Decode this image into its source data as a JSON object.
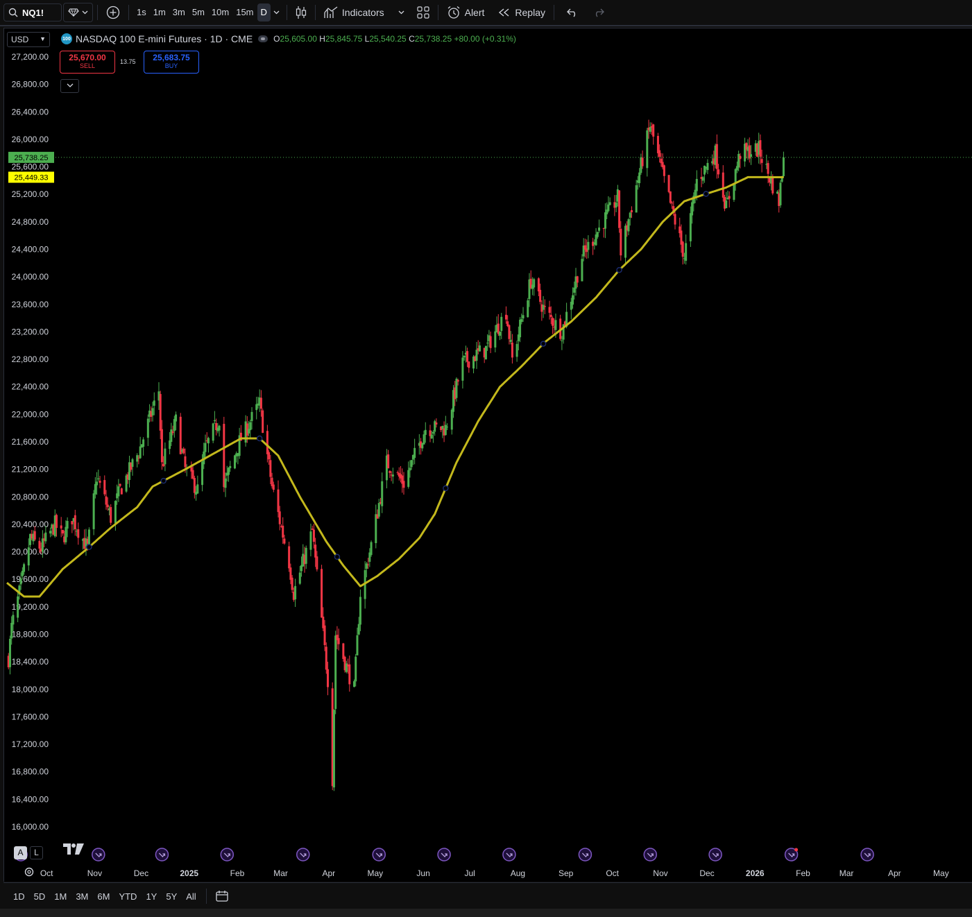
{
  "toolbar": {
    "symbol": "NQ1!",
    "timeframes": [
      "1s",
      "1m",
      "3m",
      "5m",
      "10m",
      "15m",
      "D"
    ],
    "active_timeframe": "D",
    "indicators_label": "Indicators",
    "alert_label": "Alert",
    "replay_label": "Replay"
  },
  "legend": {
    "currency": "USD",
    "logo_text": "100",
    "title": "NASDAQ 100 E-mini Futures · 1D · CME",
    "open": "25,605.00",
    "high": "25,845.75",
    "low": "25,540.25",
    "close": "25,738.25",
    "change": "+80.00 (+0.31%)",
    "o_key": "O",
    "h_key": "H",
    "l_key": "L",
    "c_key": "C"
  },
  "trade": {
    "sell_price": "25,670.00",
    "sell_label": "SELL",
    "spread": "13.75",
    "buy_price": "25,683.75",
    "buy_label": "BUY"
  },
  "scale_buttons": {
    "auto": "A",
    "log": "L"
  },
  "range_buttons": [
    "1D",
    "5D",
    "1M",
    "3M",
    "6M",
    "YTD",
    "1Y",
    "5Y",
    "All"
  ],
  "colors": {
    "up": "#4caf50",
    "down": "#f23645",
    "ma": "#c3b81c",
    "last_price_label": "#4caf50",
    "ma_label": "#ffff00",
    "background": "#000000"
  },
  "chart_data": {
    "type": "candlestick",
    "title": "NASDAQ 100 E-mini Futures · 1D · CME",
    "y_axis": {
      "ticks": [
        16000,
        16400,
        16800,
        17200,
        17600,
        18000,
        18400,
        18800,
        19200,
        19600,
        20000,
        20400,
        20800,
        21200,
        21600,
        22000,
        22400,
        22800,
        23200,
        23600,
        24000,
        24400,
        24800,
        25200,
        25600,
        26000,
        26400,
        26800,
        27200
      ],
      "tick_labels": [
        "16,000.00",
        "16,400.00",
        "16,800.00",
        "17,200.00",
        "17,600.00",
        "18,000.00",
        "18,400.00",
        "18,800.00",
        "19,200.00",
        "19,600.00",
        "20,000.00",
        "20,400.00",
        "20,800.00",
        "21,200.00",
        "21,600.00",
        "22,000.00",
        "22,400.00",
        "22,800.00",
        "23,200.00",
        "23,600.00",
        "24,000.00",
        "24,400.00",
        "24,800.00",
        "25,200.00",
        "25,600.00",
        "26,000.00",
        "26,400.00",
        "26,800.00",
        "27,200.00"
      ],
      "range": [
        15800,
        27300
      ]
    },
    "x_axis": {
      "labels": [
        "Oct",
        "Nov",
        "Dec",
        "2025",
        "Feb",
        "Mar",
        "Apr",
        "May",
        "Jun",
        "Jul",
        "Aug",
        "Sep",
        "Oct",
        "Nov",
        "Dec",
        "2026",
        "Feb",
        "Mar",
        "Apr",
        "May"
      ],
      "bold_labels": [
        "2025",
        "2026"
      ],
      "range": [
        "2024-09-09",
        "2026-05-25"
      ]
    },
    "last_price": {
      "value": 25738.25,
      "label": "25,738.25"
    },
    "ma_last": {
      "value": 25449.33,
      "label": "25,449.33"
    },
    "price_anchors": [
      [
        "2024-09-10",
        18450
      ],
      [
        "2024-09-12",
        18900
      ],
      [
        "2024-09-18",
        19500
      ],
      [
        "2024-09-24",
        20200
      ],
      [
        "2024-10-01",
        20050
      ],
      [
        "2024-10-10",
        20400
      ],
      [
        "2024-10-15",
        20200
      ],
      [
        "2024-10-21",
        20500
      ],
      [
        "2024-10-31",
        20050
      ],
      [
        "2024-11-06",
        21100
      ],
      [
        "2024-11-15",
        20500
      ],
      [
        "2024-11-21",
        20900
      ],
      [
        "2024-12-03",
        21450
      ],
      [
        "2024-12-16",
        22350
      ],
      [
        "2024-12-18",
        21250
      ],
      [
        "2024-12-27",
        21900
      ],
      [
        "2025-01-02",
        21200
      ],
      [
        "2025-01-10",
        20900
      ],
      [
        "2025-01-15",
        21500
      ],
      [
        "2025-01-24",
        21950
      ],
      [
        "2025-01-27",
        20950
      ],
      [
        "2025-02-06",
        21600
      ],
      [
        "2025-02-19",
        22150
      ],
      [
        "2025-02-27",
        20950
      ],
      [
        "2025-03-10",
        19850
      ],
      [
        "2025-03-13",
        19400
      ],
      [
        "2025-03-25",
        20300
      ],
      [
        "2025-04-04",
        18150
      ],
      [
        "2025-04-07",
        16700
      ],
      [
        "2025-04-09",
        18800
      ],
      [
        "2025-04-21",
        18000
      ],
      [
        "2025-04-25",
        19400
      ],
      [
        "2025-05-02",
        20100
      ],
      [
        "2025-05-12",
        21300
      ],
      [
        "2025-05-23",
        21000
      ],
      [
        "2025-06-06",
        21800
      ],
      [
        "2025-06-19",
        21800
      ],
      [
        "2025-06-30",
        22750
      ],
      [
        "2025-07-15",
        22950
      ],
      [
        "2025-07-28",
        23500
      ],
      [
        "2025-08-01",
        22800
      ],
      [
        "2025-08-13",
        23950
      ],
      [
        "2025-08-22",
        23500
      ],
      [
        "2025-09-02",
        23200
      ],
      [
        "2025-09-15",
        24300
      ],
      [
        "2025-09-26",
        24700
      ],
      [
        "2025-10-08",
        25150
      ],
      [
        "2025-10-10",
        24350
      ],
      [
        "2025-10-29",
        26200
      ],
      [
        "2025-11-07",
        25400
      ],
      [
        "2025-11-20",
        24300
      ],
      [
        "2025-11-28",
        25400
      ],
      [
        "2025-12-10",
        25800
      ],
      [
        "2025-12-17",
        25000
      ],
      [
        "2025-12-26",
        25800
      ],
      [
        "2026-01-07",
        25850
      ],
      [
        "2026-01-20",
        25100
      ],
      [
        "2026-01-23",
        25738
      ]
    ],
    "ma_anchors": [
      [
        "2024-09-09",
        19550
      ],
      [
        "2024-09-20",
        19350
      ],
      [
        "2024-09-30",
        19350
      ],
      [
        "2024-10-15",
        19750
      ],
      [
        "2024-10-31",
        20050
      ],
      [
        "2024-11-15",
        20350
      ],
      [
        "2024-12-02",
        20650
      ],
      [
        "2024-12-12",
        20950
      ],
      [
        "2025-01-02",
        21200
      ],
      [
        "2025-01-22",
        21450
      ],
      [
        "2025-02-07",
        21650
      ],
      [
        "2025-02-19",
        21650
      ],
      [
        "2025-03-03",
        21400
      ],
      [
        "2025-03-17",
        20800
      ],
      [
        "2025-04-03",
        20150
      ],
      [
        "2025-04-14",
        19800
      ],
      [
        "2025-04-25",
        19500
      ],
      [
        "2025-05-06",
        19650
      ],
      [
        "2025-05-20",
        19900
      ],
      [
        "2025-06-02",
        20200
      ],
      [
        "2025-06-12",
        20550
      ],
      [
        "2025-06-26",
        21300
      ],
      [
        "2025-07-10",
        21900
      ],
      [
        "2025-07-24",
        22400
      ],
      [
        "2025-08-07",
        22700
      ],
      [
        "2025-08-22",
        23050
      ],
      [
        "2025-09-08",
        23350
      ],
      [
        "2025-09-24",
        23700
      ],
      [
        "2025-10-09",
        24100
      ],
      [
        "2025-10-23",
        24400
      ],
      [
        "2025-11-06",
        24800
      ],
      [
        "2025-11-20",
        25100
      ],
      [
        "2025-12-03",
        25200
      ],
      [
        "2025-12-17",
        25300
      ],
      [
        "2025-12-31",
        25450
      ],
      [
        "2026-01-13",
        25450
      ],
      [
        "2026-01-23",
        25449
      ]
    ],
    "ma_markers": [
      "2024-11-01",
      "2024-12-19",
      "2025-02-19",
      "2025-04-10",
      "2025-06-19",
      "2025-08-21",
      "2025-10-09",
      "2025-12-04"
    ],
    "event_marker_dates": [
      "2024-09-18",
      "2024-11-07",
      "2024-12-18",
      "2025-01-29",
      "2025-03-19",
      "2025-05-07",
      "2025-06-18",
      "2025-07-30",
      "2025-09-17",
      "2025-10-29",
      "2025-12-10",
      "2026-01-28",
      "2026-03-18"
    ]
  }
}
